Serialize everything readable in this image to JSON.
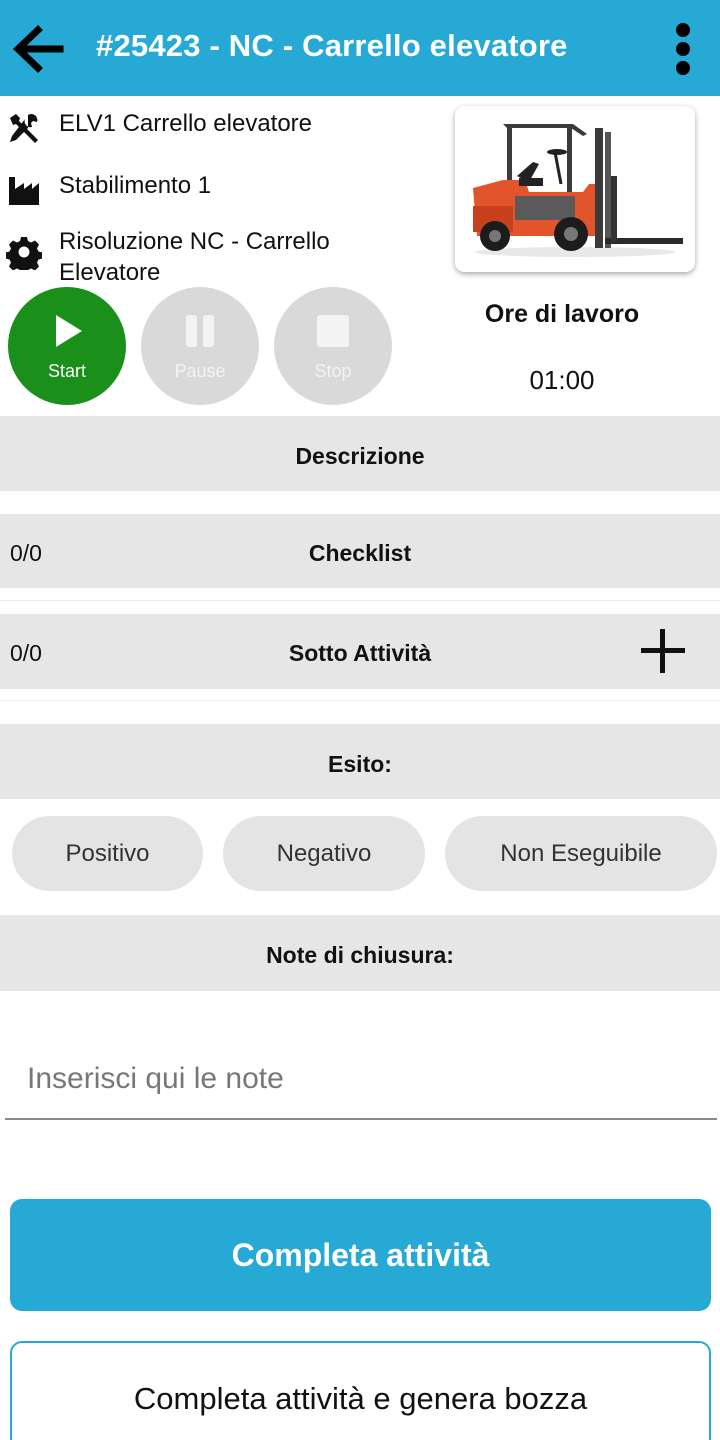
{
  "header": {
    "title": "#25423 - NC - Carrello elevatore"
  },
  "info": {
    "asset": "ELV1 Carrello elevatore",
    "location": "Stabilimento 1",
    "activity": "Risoluzione NC - Carrello Elevatore"
  },
  "timer": {
    "label": "Ore di lavoro",
    "value": "01:00"
  },
  "controls": {
    "start_label": "Start",
    "pause_label": "Pause",
    "stop_label": "Stop"
  },
  "sections": {
    "description": "Descrizione",
    "checklist": {
      "title": "Checklist",
      "count": "0/0"
    },
    "subtasks": {
      "title": "Sotto Attività",
      "count": "0/0"
    },
    "outcome": "Esito:",
    "closing_notes": "Note di chiusura:"
  },
  "outcome_options": [
    "Positivo",
    "Negativo",
    "Non Eseguibile"
  ],
  "notes": {
    "placeholder": "Inserisci qui le note"
  },
  "buttons": {
    "complete": "Completa attività",
    "complete_draft": "Completa attività e genera bozza"
  },
  "colors": {
    "primary": "#27a9d6",
    "start": "#1a8f1a",
    "disabled": "#d9d9d9",
    "band": "#e6e6e6"
  },
  "icons": {
    "back": "arrow-left-icon",
    "menu": "more-vertical-icon",
    "asset": "tools-icon",
    "location": "factory-icon",
    "activity": "gear-icon",
    "add": "plus-icon"
  }
}
